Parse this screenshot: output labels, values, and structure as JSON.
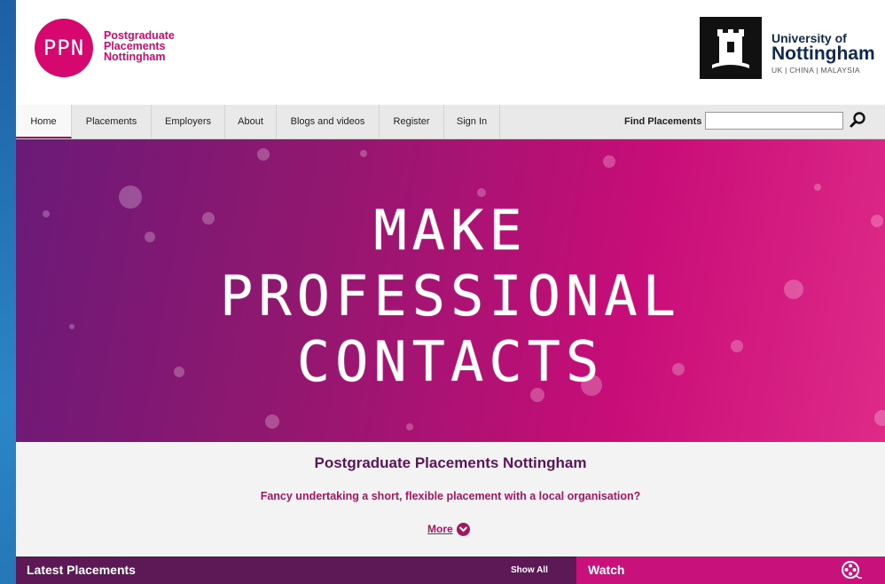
{
  "header": {
    "ppn_logo_text": "PPN",
    "ppn_name_lines": [
      "Postgraduate",
      "Placements",
      "Nottingham"
    ],
    "university_of": "University of",
    "university_name": "Nottingham",
    "university_tagline": "UK | CHINA | MALAYSIA"
  },
  "nav": {
    "items": [
      "Home",
      "Placements",
      "Employers",
      "About",
      "Blogs and videos",
      "Register",
      "Sign In"
    ],
    "active": "Home",
    "find_label": "Find Placements",
    "search_value": ""
  },
  "hero": {
    "lines": [
      "MAKE",
      "PROFESSIONAL",
      "CONTACTS"
    ]
  },
  "intro": {
    "title": "Postgraduate Placements Nottingham",
    "subtitle": "Fancy undertaking a short, flexible placement with a local organisation?",
    "more_label": "More"
  },
  "latest": {
    "title": "Latest Placements",
    "show_all": "Show All"
  },
  "watch": {
    "title": "Watch"
  },
  "colors": {
    "brand_pink": "#d6086f",
    "nav_bg": "#e9e9e9",
    "latest_bar": "#5c1955",
    "watch_bar": "#c8117a",
    "intro_title": "#5b1559",
    "intro_sub": "#a4175f"
  }
}
